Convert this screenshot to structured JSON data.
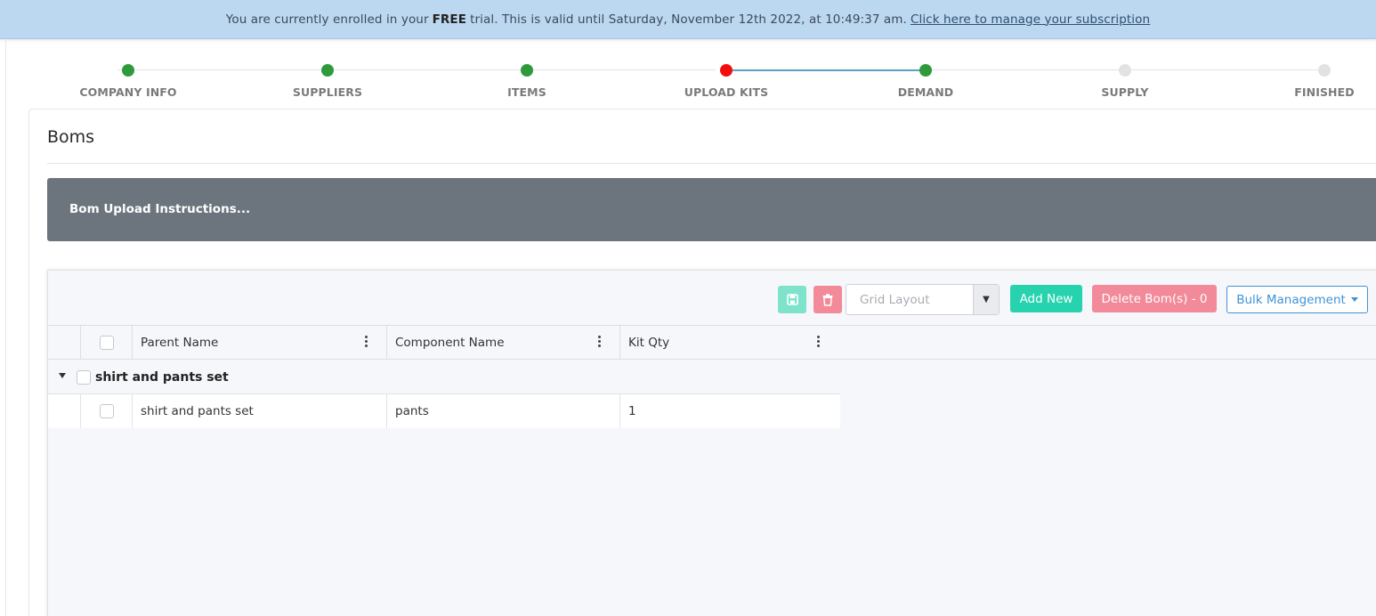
{
  "banner": {
    "prefix": "You are currently enrolled in your",
    "bold": "FREE",
    "suffix": "trial. This is valid until Saturday, November 12th 2022, at 10:49:37 am.",
    "link": "Click here to manage your subscription"
  },
  "stepper": {
    "steps": [
      {
        "label": "COMPANY INFO",
        "status": "done"
      },
      {
        "label": "SUPPLIERS",
        "status": "done"
      },
      {
        "label": "ITEMS",
        "status": "done"
      },
      {
        "label": "UPLOAD KITS",
        "status": "current"
      },
      {
        "label": "DEMAND",
        "status": "done"
      },
      {
        "label": "SUPPLY",
        "status": "pending"
      },
      {
        "label": "FINISHED",
        "status": "pending"
      }
    ],
    "colors": {
      "done": "#2e9a3c",
      "current": "#f40d0d",
      "pending": "#e2e2e2"
    }
  },
  "page": {
    "title": "Boms",
    "instructions": "Bom Upload Instructions..."
  },
  "toolbar": {
    "save_icon": "save-icon",
    "trash_icon": "trash-icon",
    "layout_placeholder": "Grid Layout",
    "add_label": "Add New",
    "delete_label": "Delete Bom(s) - 0",
    "bulk_label": "Bulk Management"
  },
  "grid": {
    "columns": [
      "Parent Name",
      "Component Name",
      "Kit Qty"
    ],
    "group": {
      "label": "shirt and pants set"
    },
    "rows": [
      {
        "parent": "shirt and pants set",
        "component": "pants",
        "qty": "1"
      }
    ]
  }
}
